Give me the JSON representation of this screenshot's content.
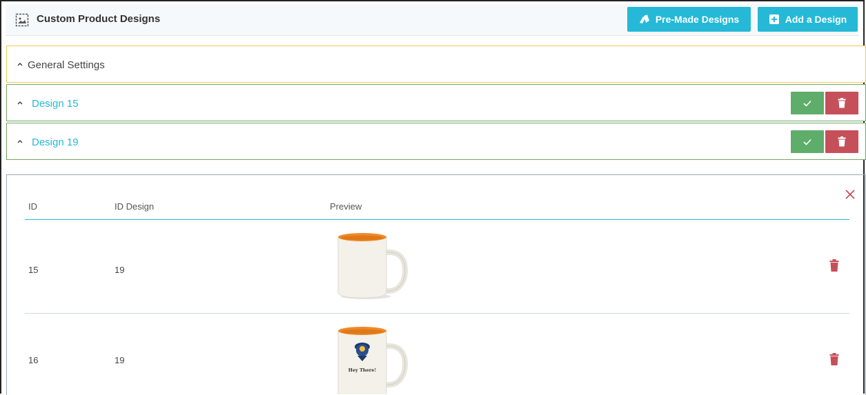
{
  "header": {
    "title": "Custom Product Designs",
    "premade_label": "Pre-Made Designs",
    "add_label": "Add a Design"
  },
  "panels": [
    {
      "label": "General Settings"
    },
    {
      "label": "Design 15"
    },
    {
      "label": "Design 19"
    }
  ],
  "table": {
    "columns": [
      "ID",
      "ID Design",
      "Preview"
    ],
    "rows": [
      {
        "id": "15",
        "id_design": "19"
      },
      {
        "id": "16",
        "id_design": "19"
      }
    ],
    "mug_print_text": "Hey There!"
  },
  "colors": {
    "accent": "#25b9d7",
    "success": "#5fad6a",
    "danger": "#c6505a",
    "warning_border": "#f0c850"
  },
  "icons": {
    "header": "image-icon",
    "premade": "pieces-icon",
    "add": "plus-square-icon",
    "check": "check-icon",
    "trash": "trash-icon",
    "close": "close-icon",
    "chevron": "chevron-up-icon"
  }
}
